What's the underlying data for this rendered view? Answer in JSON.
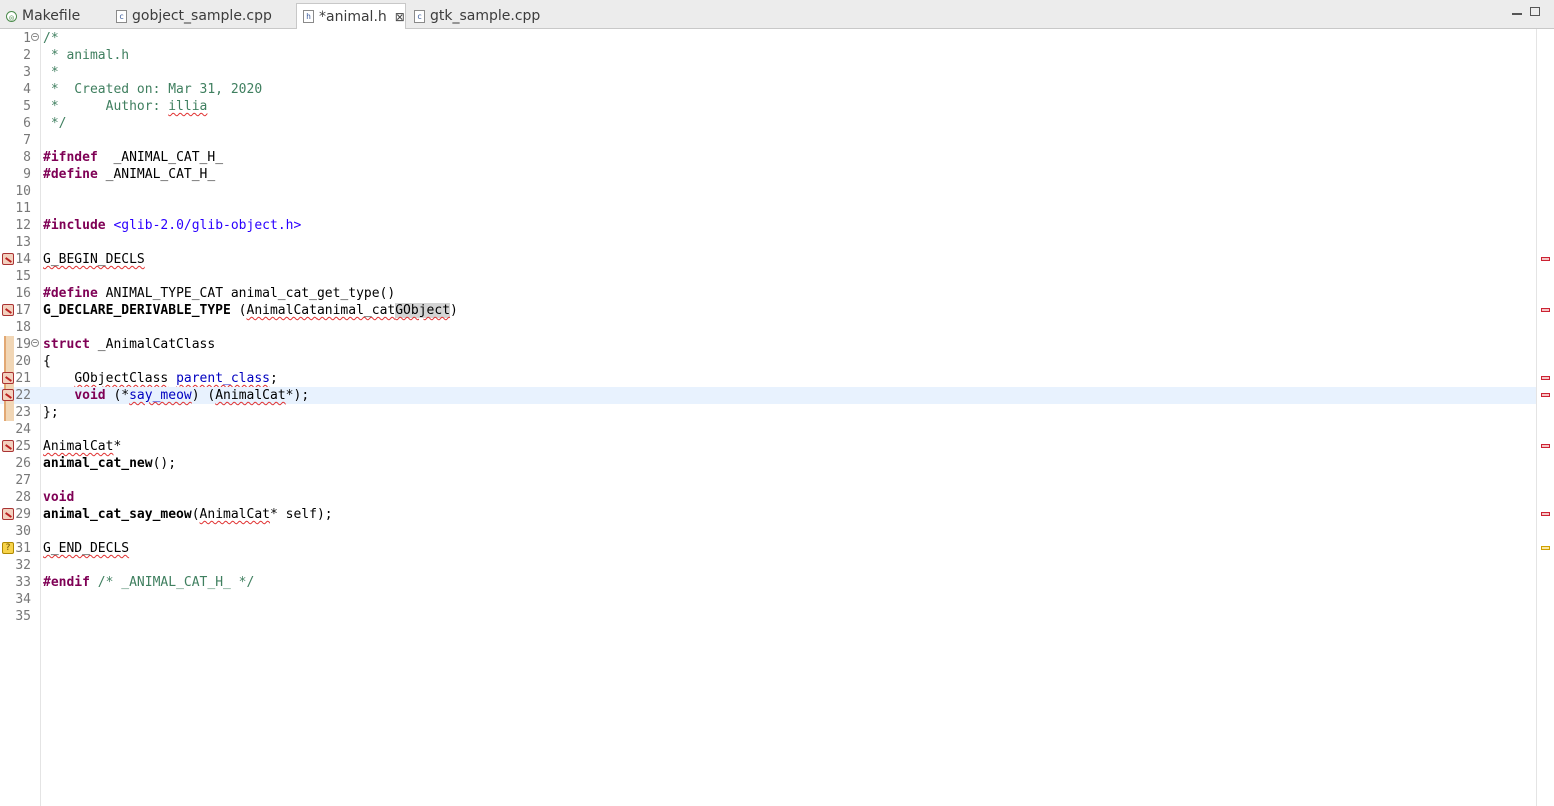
{
  "tabs": [
    {
      "label": "Makefile",
      "icon": "makefile-icon",
      "glyph": "◎",
      "active": false
    },
    {
      "label": "gobject_sample.cpp",
      "icon": "cpp-file-icon",
      "glyph": "c",
      "active": false
    },
    {
      "label": "*animal.h",
      "icon": "header-file-icon",
      "glyph": "h",
      "active": true,
      "close": "⊠"
    },
    {
      "label": "gtk_sample.cpp",
      "icon": "cpp-file-icon",
      "glyph": "c",
      "active": false
    }
  ],
  "window_controls": {
    "minimize": "minimize-icon",
    "maximize": "maximize-icon"
  },
  "current_line": 22,
  "lines": [
    {
      "n": "1",
      "fold": "⊖",
      "segs": [
        [
          "cm",
          "/*"
        ]
      ]
    },
    {
      "n": "2",
      "segs": [
        [
          "cm",
          " * animal.h"
        ]
      ]
    },
    {
      "n": "3",
      "segs": [
        [
          "cm",
          " *"
        ]
      ]
    },
    {
      "n": "4",
      "segs": [
        [
          "cm",
          " *  Created on: Mar 31, 2020"
        ]
      ]
    },
    {
      "n": "5",
      "segs": [
        [
          "cm",
          " *      Author: "
        ],
        [
          "cm sq",
          "illia"
        ]
      ]
    },
    {
      "n": "6",
      "segs": [
        [
          "cm",
          " */"
        ]
      ]
    },
    {
      "n": "7",
      "segs": []
    },
    {
      "n": "8",
      "segs": [
        [
          "kw",
          "#ifndef"
        ],
        [
          "",
          "  _ANIMAL_CAT_H_"
        ]
      ]
    },
    {
      "n": "9",
      "segs": [
        [
          "kw",
          "#define"
        ],
        [
          "",
          " _ANIMAL_CAT_H_"
        ]
      ]
    },
    {
      "n": "10",
      "segs": []
    },
    {
      "n": "11",
      "segs": []
    },
    {
      "n": "12",
      "segs": [
        [
          "kw",
          "#include"
        ],
        [
          "",
          " "
        ],
        [
          "str",
          "<glib-2.0/glib-object.h>"
        ]
      ]
    },
    {
      "n": "13",
      "segs": []
    },
    {
      "n": "14",
      "marker": "error",
      "segs": [
        [
          "sq",
          "G_BEGIN_DECLS"
        ]
      ]
    },
    {
      "n": "15",
      "segs": []
    },
    {
      "n": "16",
      "segs": [
        [
          "kw",
          "#define"
        ],
        [
          "",
          " ANIMAL_TYPE_CAT animal_cat_get_type()"
        ]
      ]
    },
    {
      "n": "17",
      "marker": "error",
      "segs": [
        [
          "fn",
          "G_DECLARE_DERIVABLE_TYPE"
        ],
        [
          "",
          " ("
        ],
        [
          "sq",
          "AnimalCat"
        ],
        [
          ", "
        ],
        [
          "sq",
          "animal_cat"
        ],
        [
          ", ANIMAL, CAT, "
        ],
        [
          "hl sq",
          "GObject"
        ],
        [
          "",
          ")"
        ]
      ]
    },
    {
      "n": "18",
      "segs": []
    },
    {
      "n": "19",
      "fold": "⊖",
      "change": true,
      "segs": [
        [
          "kw",
          "struct"
        ],
        [
          "",
          " _AnimalCatClass"
        ]
      ]
    },
    {
      "n": "20",
      "change": true,
      "segs": [
        [
          "",
          "{"
        ]
      ]
    },
    {
      "n": "21",
      "marker": "error",
      "change": true,
      "segs": [
        [
          "",
          "    "
        ],
        [
          "sq",
          "GObjectClass"
        ],
        [
          "",
          " "
        ],
        [
          "fld sq",
          "parent_class"
        ],
        [
          "",
          ";"
        ]
      ]
    },
    {
      "n": "22",
      "marker": "error",
      "change": true,
      "segs": [
        [
          "",
          "    "
        ],
        [
          "kw",
          "void"
        ],
        [
          "",
          " (*"
        ],
        [
          "fld sq",
          "say_meow"
        ],
        [
          "",
          ") ("
        ],
        [
          "sq",
          "AnimalCat"
        ],
        [
          "",
          "*);"
        ]
      ]
    },
    {
      "n": "23",
      "change": true,
      "segs": [
        [
          "",
          "};"
        ]
      ]
    },
    {
      "n": "24",
      "segs": []
    },
    {
      "n": "25",
      "marker": "error",
      "segs": [
        [
          "sq",
          "AnimalCat"
        ],
        [
          "",
          "*"
        ]
      ]
    },
    {
      "n": "26",
      "segs": [
        [
          "fn",
          "animal_cat_new"
        ],
        [
          "",
          "();"
        ]
      ]
    },
    {
      "n": "27",
      "segs": []
    },
    {
      "n": "28",
      "segs": [
        [
          "kw",
          "void"
        ]
      ]
    },
    {
      "n": "29",
      "marker": "error",
      "segs": [
        [
          "fn",
          "animal_cat_say_meow"
        ],
        [
          "",
          "("
        ],
        [
          "sq",
          "AnimalCat"
        ],
        [
          "",
          "* self);"
        ]
      ]
    },
    {
      "n": "30",
      "segs": []
    },
    {
      "n": "31",
      "marker": "warning",
      "marker_glyph": "?",
      "segs": [
        [
          "sq",
          "G_END_DECLS"
        ]
      ]
    },
    {
      "n": "32",
      "segs": []
    },
    {
      "n": "33",
      "segs": [
        [
          "kw",
          "#endif"
        ],
        [
          "",
          " "
        ],
        [
          "cm",
          "/* _ANIMAL_CAT_H_ */"
        ]
      ]
    },
    {
      "n": "34",
      "segs": []
    },
    {
      "n": "35",
      "segs": []
    }
  ],
  "overview_markers": [
    {
      "line": 14,
      "type": "error"
    },
    {
      "line": 17,
      "type": "error"
    },
    {
      "line": 21,
      "type": "error"
    },
    {
      "line": 22,
      "type": "error"
    },
    {
      "line": 25,
      "type": "error"
    },
    {
      "line": 29,
      "type": "error"
    },
    {
      "line": 31,
      "type": "warning"
    }
  ]
}
